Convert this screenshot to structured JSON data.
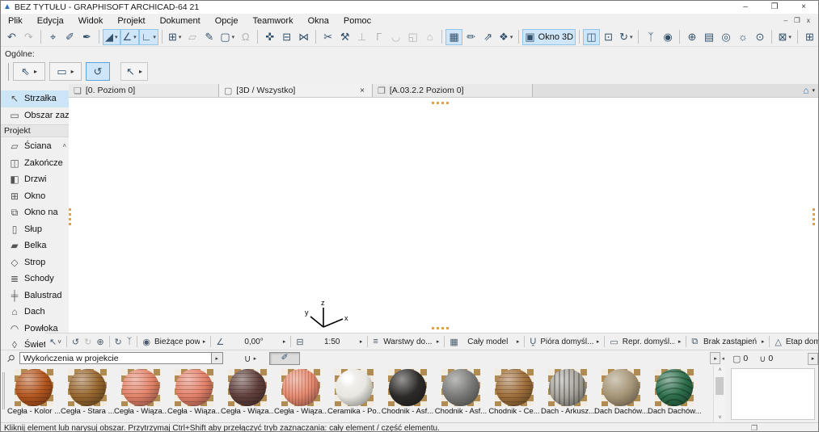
{
  "window": {
    "title": "BEZ TYTUŁU - GRAPHISOFT ARCHICAD-64 21",
    "app_icon_glyph": "▲",
    "minimize": "–",
    "restore": "❐",
    "close": "×",
    "mdi_minimize": "–",
    "mdi_restore": "❐",
    "mdi_close": "x"
  },
  "menu": {
    "items": [
      "Plik",
      "Edycja",
      "Widok",
      "Projekt",
      "Dokument",
      "Opcje",
      "Teamwork",
      "Okna",
      "Pomoc"
    ]
  },
  "toolbar": {
    "groups": [
      {
        "items": [
          {
            "name": "undo",
            "glyph": "↶"
          },
          {
            "name": "redo",
            "glyph": "↷",
            "disabled": true
          }
        ]
      },
      {
        "items": [
          {
            "name": "select-special",
            "glyph": "⌖"
          },
          {
            "name": "pick-up-parameters",
            "glyph": "✐"
          },
          {
            "name": "inject-parameters",
            "glyph": "✒"
          }
        ]
      },
      {
        "items": [
          {
            "name": "guide-lines",
            "glyph": "◢",
            "active": true,
            "dropdown": true
          },
          {
            "name": "snap-guides",
            "glyph": "∠",
            "active": true,
            "dropdown": true
          },
          {
            "name": "snap-points",
            "glyph": "∟",
            "active": true,
            "dropdown": true
          }
        ]
      },
      {
        "items": [
          {
            "name": "snap-grid",
            "glyph": "⊞",
            "dropdown": true
          },
          {
            "name": "editing-plane",
            "glyph": "▱",
            "disabled": true
          },
          {
            "name": "magic-wand",
            "glyph": "✎"
          },
          {
            "name": "selection-style",
            "glyph": "▢",
            "dropdown": true
          },
          {
            "name": "lock",
            "glyph": "Ω",
            "disabled": true
          }
        ]
      },
      {
        "items": [
          {
            "name": "move-transform",
            "glyph": "✜"
          },
          {
            "name": "measure",
            "glyph": "⊟"
          },
          {
            "name": "stretch",
            "glyph": "⋈"
          }
        ]
      },
      {
        "items": [
          {
            "name": "trim",
            "glyph": "✂"
          },
          {
            "name": "split",
            "glyph": "⚒"
          },
          {
            "name": "adjust",
            "glyph": "⊥",
            "disabled": true
          },
          {
            "name": "fillet",
            "glyph": "Γ",
            "disabled": true
          },
          {
            "name": "curve-edit",
            "glyph": "◡",
            "disabled": true
          },
          {
            "name": "resize",
            "glyph": "◱",
            "disabled": true
          },
          {
            "name": "roof-tool",
            "glyph": "⌂",
            "disabled": true
          }
        ]
      },
      {
        "items": [
          {
            "name": "marquee-3d",
            "glyph": "▦",
            "active": true
          },
          {
            "name": "edit-elements",
            "glyph": "✏"
          },
          {
            "name": "extrude",
            "glyph": "⇗"
          },
          {
            "name": "rotate-3d",
            "glyph": "❖",
            "dropdown": true
          }
        ]
      },
      {
        "items": [
          {
            "name": "okno-3d",
            "glyph": "▣",
            "label": "Okno 3D",
            "active": true
          }
        ]
      },
      {
        "items": [
          {
            "name": "cutaway",
            "glyph": "◫",
            "active": true
          },
          {
            "name": "axonometry",
            "glyph": "⊡"
          },
          {
            "name": "orbit-view",
            "glyph": "↻",
            "dropdown": true
          }
        ]
      },
      {
        "items": [
          {
            "name": "walk-mode",
            "glyph": "ᛉ"
          },
          {
            "name": "explore-model",
            "glyph": "◉"
          }
        ]
      },
      {
        "items": [
          {
            "name": "parallel-projection",
            "glyph": "⊕"
          },
          {
            "name": "perspective-settings",
            "glyph": "▤"
          },
          {
            "name": "camera",
            "glyph": "◎"
          },
          {
            "name": "sun-settings",
            "glyph": "☼"
          },
          {
            "name": "view-cone",
            "glyph": "⊙"
          }
        ]
      },
      {
        "items": [
          {
            "name": "filter-elements-3d",
            "glyph": "⊠",
            "dropdown": true
          }
        ]
      },
      {
        "items": [
          {
            "name": "marquee-overflow",
            "glyph": "⊞"
          }
        ]
      }
    ]
  },
  "general_palette": {
    "label": "Ogólne:",
    "items": [
      {
        "name": "drag-mode",
        "glyph": "⇖",
        "arrow": true
      },
      {
        "name": "marquee-mode",
        "glyph": "▭",
        "arrow": true
      },
      {
        "name": "grab-orbit-mode",
        "glyph": "↺",
        "active": true
      },
      {
        "name": "arrow-mode",
        "glyph": "↖",
        "arrow": true,
        "gap": true
      }
    ]
  },
  "tabs": {
    "items": [
      {
        "id": "plan",
        "icon": "floor-plan",
        "glyph": "❏",
        "label": "[0. Poziom 0]"
      },
      {
        "id": "3d",
        "icon": "cube-3d",
        "glyph": "▢",
        "label": "[3D / Wszystko]",
        "close": "×",
        "active": true
      },
      {
        "id": "layout",
        "icon": "layout-sheet",
        "glyph": "❐",
        "label": "[A.03.2.2 Poziom 0]"
      }
    ],
    "navigator_glyph": "⌂",
    "navigator_arrow": "▾"
  },
  "toolbox": {
    "scroll_up": "˄",
    "scroll_down": "˅",
    "items": [
      {
        "type": "tool",
        "name": "strzalka",
        "glyph": "↖",
        "label": "Strzałka",
        "selected": true
      },
      {
        "type": "tool",
        "name": "obszar-zaznaczenia",
        "glyph": "▭",
        "label": "Obszar zaz"
      },
      {
        "type": "header",
        "label": "Projekt"
      },
      {
        "type": "tool",
        "name": "sciana",
        "glyph": "▱",
        "label": "Ściana"
      },
      {
        "type": "tool",
        "name": "zakonczenie-sciany",
        "glyph": "◫",
        "label": "Zakończe"
      },
      {
        "type": "tool",
        "name": "drzwi",
        "glyph": "◧",
        "label": "Drzwi"
      },
      {
        "type": "tool",
        "name": "okno",
        "glyph": "⊞",
        "label": "Okno"
      },
      {
        "type": "tool",
        "name": "okno-narozne",
        "glyph": "⧉",
        "label": "Okno na"
      },
      {
        "type": "tool",
        "name": "slup",
        "glyph": "▯",
        "label": "Słup"
      },
      {
        "type": "tool",
        "name": "belka",
        "glyph": "▰",
        "label": "Belka"
      },
      {
        "type": "tool",
        "name": "strop",
        "glyph": "◇",
        "label": "Strop"
      },
      {
        "type": "tool",
        "name": "schody",
        "glyph": "≣",
        "label": "Schody"
      },
      {
        "type": "tool",
        "name": "balustrada",
        "glyph": "╪",
        "label": "Balustrad"
      },
      {
        "type": "tool",
        "name": "dach",
        "glyph": "⌂",
        "label": "Dach"
      },
      {
        "type": "tool",
        "name": "powloka",
        "glyph": "◠",
        "label": "Powłoka"
      },
      {
        "type": "tool",
        "name": "swietlik",
        "glyph": "◊",
        "label": "Świetlik"
      }
    ]
  },
  "canvas": {
    "axis": {
      "x": "x",
      "y": "y",
      "z": "z"
    }
  },
  "bottombar": {
    "groups": [
      {
        "items": [
          {
            "name": "quick-select",
            "glyph": "↖",
            "chevron": "˅"
          }
        ]
      },
      {
        "items": [
          {
            "name": "back-view",
            "glyph": "↺"
          },
          {
            "name": "forward-view",
            "glyph": "↻",
            "disabled": true
          },
          {
            "name": "zoom-in",
            "glyph": "⊕"
          }
        ]
      },
      {
        "items": [
          {
            "name": "orbit",
            "glyph": "↻"
          },
          {
            "name": "walk",
            "glyph": "ᛉ"
          }
        ]
      },
      {
        "items": [
          {
            "name": "zoom-preset",
            "glyph": "◉",
            "label": "Bieżące powi...",
            "arrow": "▸"
          }
        ]
      },
      {
        "items": [
          {
            "name": "rotation-angle",
            "glyph": "∠",
            "label": "0,00°",
            "arrow": "▸"
          }
        ]
      },
      {
        "items": [
          {
            "name": "scale",
            "glyph": "⊟",
            "label": "1:50",
            "arrow": "▸"
          }
        ]
      },
      {
        "items": [
          {
            "name": "layers",
            "glyph": "≡",
            "label": "Warstwy do...",
            "arrow": "▸"
          }
        ]
      },
      {
        "items": [
          {
            "name": "model-view",
            "glyph": "▦",
            "label": "Cały model",
            "arrow": "▸"
          }
        ]
      },
      {
        "items": [
          {
            "name": "pen-sets",
            "glyph": "Ṷ",
            "label": "Pióra domyśl...",
            "arrow": "▸"
          }
        ]
      },
      {
        "items": [
          {
            "name": "representation",
            "glyph": "▭",
            "label": "Repr. domyśl...",
            "arrow": "▸"
          }
        ]
      },
      {
        "items": [
          {
            "name": "graphic-overrides",
            "glyph": "⧉",
            "label": "Brak zastąpień",
            "arrow": "▸"
          }
        ]
      },
      {
        "items": [
          {
            "name": "renovation-stage",
            "glyph": "△",
            "label": "Etap domyślny",
            "arrow": "▸"
          }
        ]
      }
    ]
  },
  "search": {
    "icon_glyph": "⚲",
    "value": "Wykończenia w projekcie",
    "dropdown": "▸",
    "bucket_glyph": "∪",
    "bucket_arrow": "▸",
    "eyedropper_glyph": "✐",
    "more": "▸",
    "collapse": "◂"
  },
  "rightpanel": {
    "model_icon": "▢",
    "model_count": "0",
    "bucket_icon": "∪",
    "paint_count": "0",
    "more": "▸"
  },
  "materials": {
    "scroll_up": "˄",
    "scroll_down": "˅",
    "items": [
      {
        "label": "Cegła - Kolor ...",
        "color": "#b3561f",
        "texture": "brick"
      },
      {
        "label": "Cegła - Stara ...",
        "color": "#96672f",
        "texture": "brick"
      },
      {
        "label": "Cegła - Wiąza...",
        "color": "#e2836a",
        "texture": "brick"
      },
      {
        "label": "Cegła - Wiąza...",
        "color": "#e2816a",
        "texture": "brick"
      },
      {
        "label": "Cegła - Wiąza...",
        "color": "#5f403c",
        "texture": "brick"
      },
      {
        "label": "Cegła - Wiąza...",
        "color": "#e68a70",
        "texture": "brick-v"
      },
      {
        "label": "Ceramika - Po...",
        "color": "#e9e7e1",
        "texture": "gloss"
      },
      {
        "label": "Chodnik - Asf...",
        "color": "#2d2b29",
        "texture": "rough"
      },
      {
        "label": "Chodnik - Asf...",
        "color": "#787876",
        "texture": "rough"
      },
      {
        "label": "Chodnik - Ce...",
        "color": "#9e6f3b",
        "texture": "brick"
      },
      {
        "label": "Dach - Arkusz...",
        "color": "#a8a49c",
        "texture": "stripe"
      },
      {
        "label": "Dach Dachów...",
        "color": "#a59476",
        "texture": "rough"
      },
      {
        "label": "Dach Dachów...",
        "color": "#2e6e4c",
        "texture": "scale"
      }
    ]
  },
  "statusbar": {
    "text": "Kliknij element lub narysuj obszar. Przytrzymaj Ctrl+Shift aby przełączyć tryb zaznaczania: cały element / część elementu.",
    "window_icon": "❐"
  }
}
